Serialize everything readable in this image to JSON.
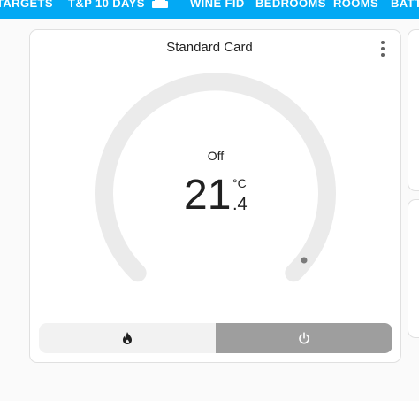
{
  "tabs": [
    {
      "label": "TARGETS"
    },
    {
      "label": "T&P 10 DAYS"
    },
    {
      "label": "WINE FID"
    },
    {
      "label": "BEDROOMS"
    },
    {
      "label": "ROOMS"
    },
    {
      "label": "BATT"
    }
  ],
  "card": {
    "title": "Standard Card",
    "state": "Off",
    "temperature": {
      "integer": "21",
      "decimal": ".4",
      "unit": "°C"
    },
    "dial_position": 1.0
  },
  "modes": [
    {
      "name": "heat",
      "icon": "flame-icon",
      "active": false
    },
    {
      "name": "off",
      "icon": "power-icon",
      "active": true
    }
  ],
  "colors": {
    "header": "#03a9f4",
    "dial_track": "#ebebeb",
    "active_mode": "#9e9e9e",
    "inactive_mode": "#f2f2f2"
  }
}
